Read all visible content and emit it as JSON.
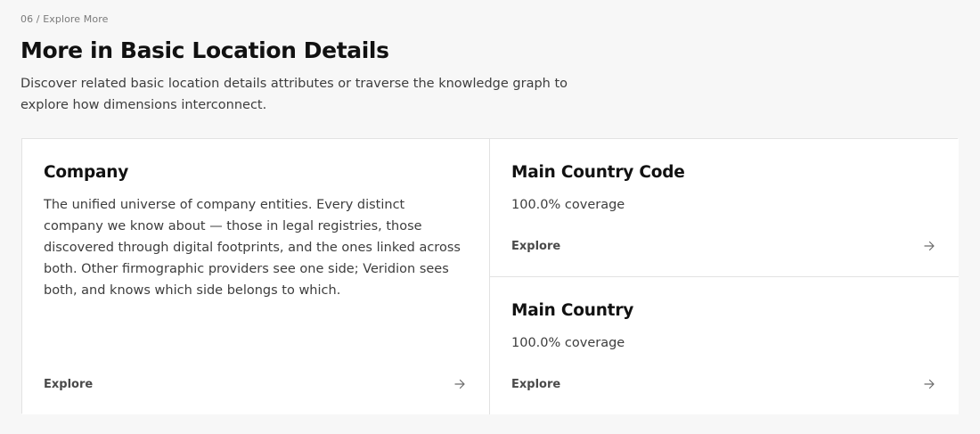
{
  "section": {
    "eyebrow": "06 / Explore More",
    "title": "More in Basic Location Details",
    "lead": "Discover related basic location details attributes or traverse the knowledge graph to explore how dimensions interconnect."
  },
  "cards": [
    {
      "title": "Company",
      "description": "The unified universe of company entities. Every distinct company we know about — those in legal registries, those discovered through digital footprints, and the ones linked across both. Other firmographic providers see one side; Veridion sees both, and knows which side belongs to which.",
      "action_label": "Explore",
      "icon": "arrow-right-icon"
    },
    {
      "title": "Main Country Code",
      "coverage": "100.0% coverage",
      "action_label": "Explore",
      "icon": "arrow-right-icon"
    },
    {
      "title": "Main Country",
      "coverage": "100.0% coverage",
      "action_label": "Explore",
      "icon": "arrow-right-icon"
    }
  ]
}
